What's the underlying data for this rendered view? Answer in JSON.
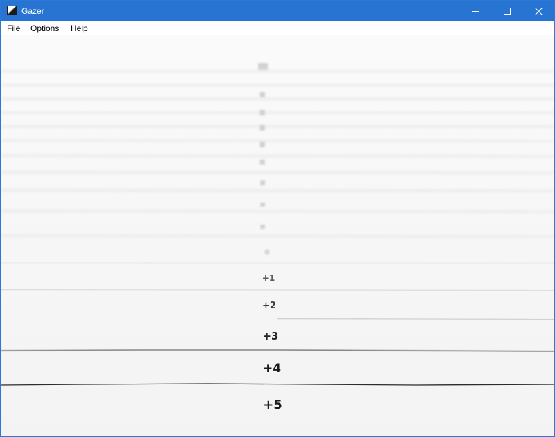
{
  "window": {
    "title": "Gazer",
    "title_color": "#2874d3"
  },
  "titlebar_buttons": {
    "minimize_icon": "minimize-icon",
    "maximize_icon": "maximize-icon",
    "close_icon": "close-icon"
  },
  "menu": {
    "file": "File",
    "options": "Options",
    "help": "Help"
  },
  "scale": {
    "labels": [
      "+1",
      "+2",
      "+3",
      "+4",
      "+5"
    ]
  }
}
